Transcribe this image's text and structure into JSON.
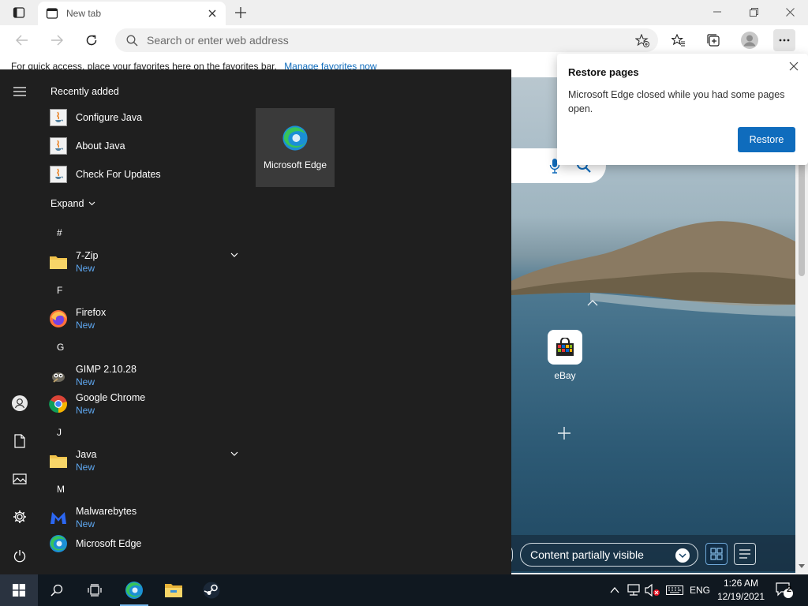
{
  "browser": {
    "tab_title": "New tab",
    "address_placeholder": "Search or enter web address",
    "favbar_text": "For quick access, place your favorites here on the favorites bar.",
    "favbar_link": "Manage favorites now",
    "accent": "#0f6cbd"
  },
  "restore_popup": {
    "title": "Restore pages",
    "message": "Microsoft Edge closed while you had some pages open.",
    "button": "Restore"
  },
  "newtab_page": {
    "quick_link_label": "eBay",
    "content_visibility": "Content partially visible"
  },
  "start_menu": {
    "recently_added_title": "Recently added",
    "recent": [
      {
        "name": "Configure Java",
        "icon": "java-icon"
      },
      {
        "name": "About Java",
        "icon": "java-icon"
      },
      {
        "name": "Check For Updates",
        "icon": "java-icon"
      }
    ],
    "expand_label": "Expand",
    "letters": {
      "hash": "#",
      "f": "F",
      "g": "G",
      "j": "J",
      "m": "M"
    },
    "apps": [
      {
        "name": "7-Zip",
        "badge": "New"
      },
      {
        "name": "Firefox",
        "badge": "New"
      },
      {
        "name": "GIMP 2.10.28",
        "badge": "New"
      },
      {
        "name": "Google Chrome",
        "badge": "New"
      },
      {
        "name": "Java",
        "badge": "New"
      },
      {
        "name": "Malwarebytes",
        "badge": "New"
      },
      {
        "name": "Microsoft Edge"
      }
    ],
    "tile_label": "Microsoft Edge"
  },
  "taskbar": {
    "language": "ENG",
    "time": "1:26 AM",
    "date": "12/19/2021",
    "notification_count": "2"
  }
}
